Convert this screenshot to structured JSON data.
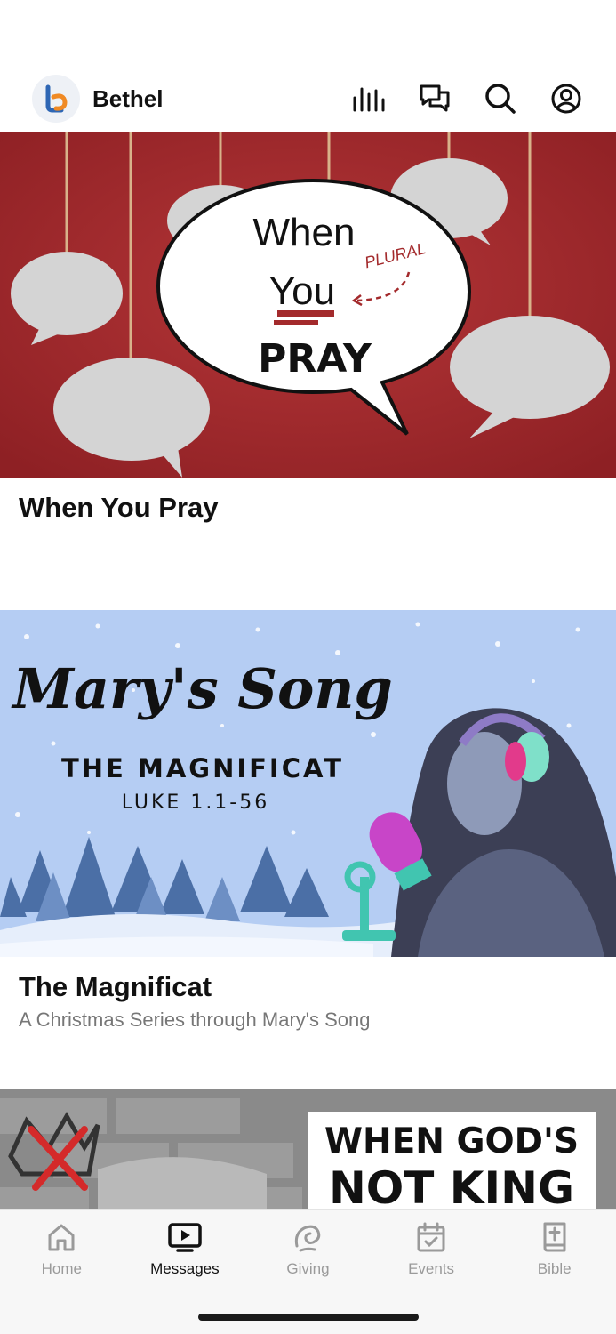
{
  "header": {
    "brand_name": "Bethel",
    "icons": [
      "audio-bars-icon",
      "chat-icon",
      "search-icon",
      "profile-icon"
    ]
  },
  "feed": [
    {
      "title": "When You Pray",
      "subtitle": "",
      "art_text": {
        "line1": "When",
        "line2": "You",
        "line3": "PRAY",
        "annotation": "PLURAL"
      }
    },
    {
      "title": "The Magnificat",
      "subtitle": "A Christmas Series through Mary's Song",
      "art_text": {
        "script": "Mary's Song",
        "heading": "THE MAGNIFICAT",
        "reference": "LUKE 1.1-56"
      }
    },
    {
      "title": "",
      "subtitle": "",
      "art_text": {
        "line1": "WHEN GOD'S",
        "line2": "NOT KING"
      }
    }
  ],
  "tabbar": {
    "tabs": [
      {
        "label": "Home",
        "icon": "home-icon",
        "active": false
      },
      {
        "label": "Messages",
        "icon": "tv-icon",
        "active": true
      },
      {
        "label": "Giving",
        "icon": "giving-icon",
        "active": false
      },
      {
        "label": "Events",
        "icon": "calendar-icon",
        "active": false
      },
      {
        "label": "Bible",
        "icon": "bible-icon",
        "active": false
      }
    ]
  },
  "colors": {
    "accent_red": "#a32a2c",
    "sky_blue": "#b5cdf3",
    "brand_blue": "#2e66b4",
    "brand_orange": "#f08a24"
  }
}
